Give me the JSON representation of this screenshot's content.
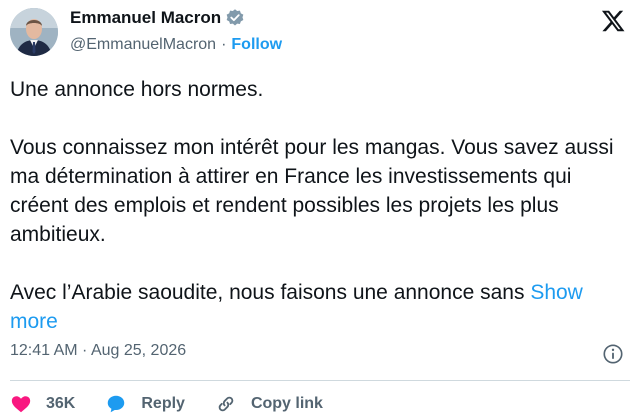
{
  "author": {
    "display_name": "Emmanuel Macron",
    "handle": "@EmmanuelMacron",
    "separator": "·",
    "follow_label": "Follow"
  },
  "tweet": {
    "paragraphs": [
      "Une annonce hors normes.",
      "Vous connaissez mon intérêt pour les mangas. Vous savez aussi ma détermination à attirer en France les investissements qui créent des emplois et rendent possibles les projets les plus ambitieux.",
      "Avec l’Arabie saoudite, nous faisons une annonce sans"
    ],
    "show_more_label": "Show more",
    "timestamp": "12:41 AM · Aug 25, 2026"
  },
  "actions": {
    "likes_count": "36K",
    "reply_label": "Reply",
    "copy_link_label": "Copy link"
  },
  "icons": {
    "verified": "verified-badge-icon",
    "x_logo": "x-logo-icon",
    "info": "info-icon",
    "heart": "heart-icon",
    "reply": "reply-bubble-icon",
    "link": "link-icon"
  },
  "colors": {
    "accent": "#1d9bf0",
    "like": "#f91880",
    "text": "#0f1419",
    "muted": "#536471"
  }
}
